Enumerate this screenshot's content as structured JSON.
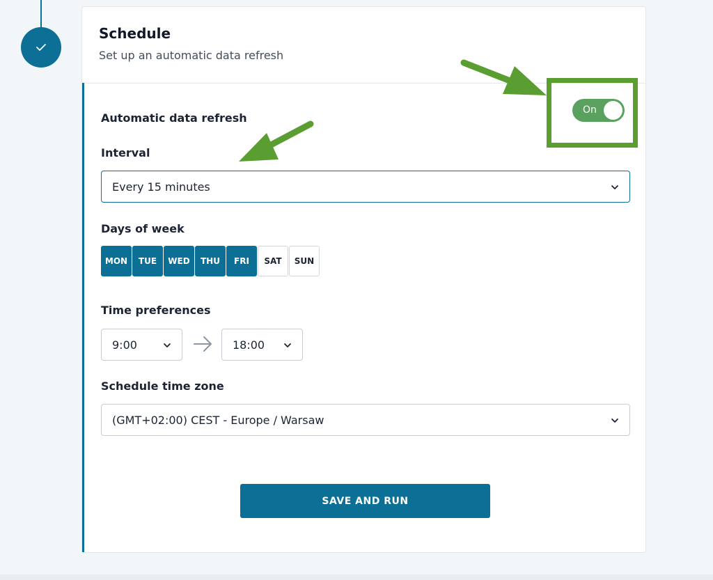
{
  "schedule": {
    "title": "Schedule",
    "subtitle": "Set up an automatic data refresh",
    "auto_refresh_label": "Automatic data refresh",
    "toggle_label": "On",
    "toggle_state": true,
    "interval_label": "Interval",
    "interval_value": "Every 15 minutes",
    "days_label": "Days of week",
    "days": [
      {
        "label": "MON",
        "selected": true
      },
      {
        "label": "TUE",
        "selected": true
      },
      {
        "label": "WED",
        "selected": true
      },
      {
        "label": "THU",
        "selected": true
      },
      {
        "label": "FRI",
        "selected": true
      },
      {
        "label": "SAT",
        "selected": false
      },
      {
        "label": "SUN",
        "selected": false
      }
    ],
    "time_label": "Time preferences",
    "time_from": "9:00",
    "time_to": "18:00",
    "timezone_label": "Schedule time zone",
    "timezone_value": "(GMT+02:00) CEST - Europe / Warsaw",
    "save_label": "SAVE AND RUN"
  },
  "colors": {
    "accent": "#0b6f96",
    "toggle_on": "#5aa05e",
    "annotation": "#5a9e32"
  },
  "icons": {
    "step": "check-icon",
    "dropdown": "chevron-down-icon",
    "time_range": "arrow-right-icon"
  }
}
